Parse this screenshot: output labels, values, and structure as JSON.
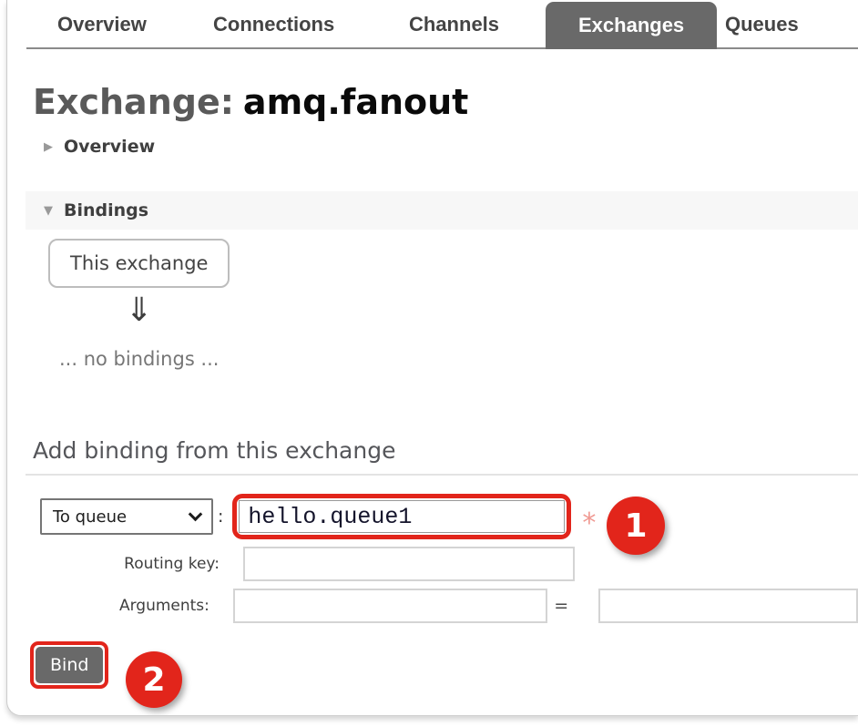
{
  "tabs": {
    "overview": "Overview",
    "connections": "Connections",
    "channels": "Channels",
    "exchanges": "Exchanges",
    "queues": "Queues",
    "active_tab": "Exchanges"
  },
  "header": {
    "title_prefix": "Exchange:",
    "title_name": "amq.fanout"
  },
  "overview_section": {
    "toggle_icon": "▶",
    "label": "Overview"
  },
  "bindings_section": {
    "toggle_icon": "▼",
    "label": "Bindings",
    "this_exchange_label": "This exchange",
    "arrow_down": "⇓",
    "no_bindings_text": "... no bindings ..."
  },
  "add_binding": {
    "header": "Add binding from this exchange",
    "destination_type": "To queue",
    "separator": ":",
    "destination_value": "hello.queue1",
    "required_marker": "*",
    "routing_key_label": "Routing key:",
    "routing_key_value": "",
    "arguments_label": "Arguments:",
    "argument_key": "",
    "equals_sign": "=",
    "argument_value": "",
    "bind_button_label": "Bind"
  },
  "annotations": {
    "step_1": "1",
    "step_2": "2",
    "highlight_color": "#e2251b"
  },
  "icons": {
    "select_chevron": "chevron-down",
    "overview_toggle": "triangle-right",
    "bindings_toggle": "triangle-down",
    "binding_flow": "double-arrow-down"
  }
}
